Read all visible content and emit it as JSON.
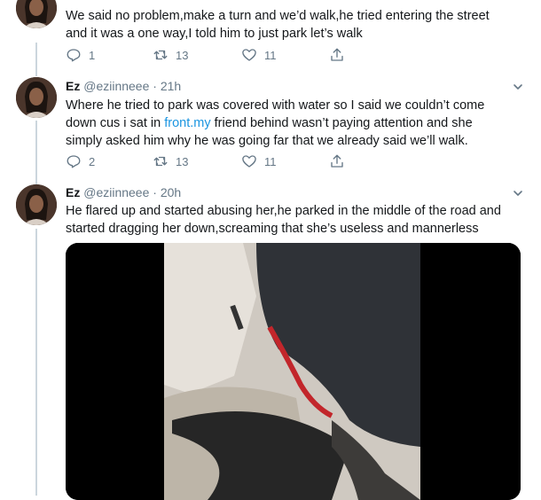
{
  "tweets": [
    {
      "text": "We said no problem,make a turn and we’d walk,he tried entering the street and it was a one way,I told him to just park let’s walk",
      "replies": "1",
      "retweets": "13",
      "likes": "11"
    },
    {
      "name": "Ez",
      "handle": "@eziinneee",
      "separator": "·",
      "time": "21h",
      "text_before_link": "Where he tried to park was covered with water so I said we couldn’t come down cus i sat in ",
      "link_text": "front.my",
      "text_after_link": " friend behind wasn’t paying attention and she simply asked him why he was going far that we already said we’ll walk.",
      "replies": "2",
      "retweets": "13",
      "likes": "11"
    },
    {
      "name": "Ez",
      "handle": "@eziinneee",
      "separator": "·",
      "time": "20h",
      "text": "He flared up and started abusing her,he parked in the middle of the road and started dragging her down,screaming that she’s useless and mannerless"
    }
  ],
  "icons": {
    "reply": "reply-icon",
    "retweet": "retweet-icon",
    "like": "heart-icon",
    "share": "share-icon",
    "caret": "chevron-down-icon"
  },
  "colors": {
    "link": "#1b95e0",
    "muted": "#657786",
    "thread_line": "#ccd6dd"
  }
}
